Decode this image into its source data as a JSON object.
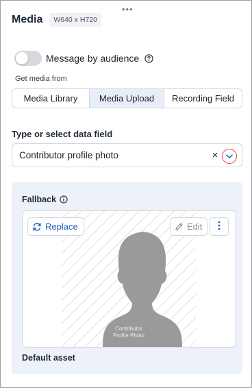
{
  "header": {
    "title": "Media",
    "size_badge": "W640 x H720",
    "drag_handle": "•••"
  },
  "audience_toggle": {
    "label": "Message by audience",
    "enabled": false,
    "help_icon": "question-circle-icon"
  },
  "media_source": {
    "label": "Get media from",
    "options": [
      "Media Library",
      "Media Upload",
      "Recording Field"
    ],
    "selected": "Media Upload"
  },
  "data_field": {
    "label": "Type or select data field",
    "value": "Contributor profile photo",
    "clear_icon": "×",
    "dropdown_icon": "chevron-down-icon"
  },
  "fallback": {
    "title": "Fallback",
    "info_icon": "info-circle-icon",
    "replace_label": "Replace",
    "edit_label": "Edit",
    "more_icon": "more-vertical-icon",
    "image_caption_line1": "Contributor",
    "image_caption_line2": "Profile Photo",
    "default_asset_label": "Default asset"
  },
  "colors": {
    "accent": "#1e63c4",
    "selected_segment": "#e8eef9",
    "panel_bg": "#edf1f9",
    "highlight_ring": "#e0423b",
    "silhouette": "#9a9a9a"
  }
}
